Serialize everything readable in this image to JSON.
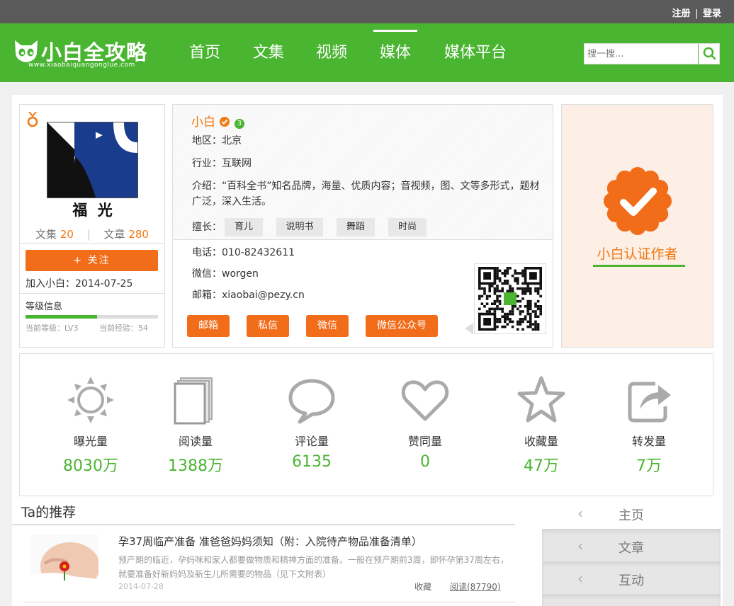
{
  "topbar": {
    "register": "注册",
    "divider": "|",
    "login": "登录"
  },
  "header": {
    "logo_title": "小白全攻略",
    "logo_url": "www.xiaobaiquangonglue.com",
    "nav": [
      "首页",
      "文集",
      "视频",
      "媒体",
      "媒体平台"
    ],
    "nav_active": "媒体",
    "search_placeholder": "搜一搜..."
  },
  "profile": {
    "avatar_text": "福  光",
    "collections_label": "文集",
    "collections": "20",
    "articles_label": "文章",
    "articles": "280",
    "follow": "+ 关注",
    "joined": "加入小白：2014-07-25",
    "level_title": "等级信息",
    "level_progress": 0.54,
    "current_level": "当前等级：LV3",
    "current_exp": "当前经验：54"
  },
  "info": {
    "name": "小白",
    "level_badge": "3",
    "region": "地区：北京",
    "industry": "行业：互联网",
    "intro": "介绍：“百科全书”知名品牌，海量、优质内容；音视频，图、文等多形式，题材广泛，深入生活。",
    "skills_label": "擅长：",
    "tags": [
      "育儿",
      "说明书",
      "舞蹈",
      "时尚"
    ],
    "phone": "电话：010-82432611",
    "wechat": "微信：worgen",
    "email": "邮箱：xiaobai@pezy.cn",
    "buttons": [
      "邮箱",
      "私信",
      "微信",
      "微信公众号"
    ]
  },
  "verify": {
    "title": "小白认证作者"
  },
  "stats": [
    {
      "label": "曝光量",
      "value": "8030万",
      "icon": "sun-icon"
    },
    {
      "label": "阅读量",
      "value": "1388万",
      "icon": "document-stack-icon"
    },
    {
      "label": "评论量",
      "value": "6135",
      "icon": "speech-bubble-icon"
    },
    {
      "label": "赞同量",
      "value": "0",
      "icon": "heart-icon"
    },
    {
      "label": "收藏量",
      "value": "47万",
      "icon": "star-icon"
    },
    {
      "label": "转发量",
      "value": "7万",
      "icon": "share-icon"
    }
  ],
  "recommend": {
    "title": "Ta的推荐",
    "article": {
      "title": "孕37周临产准备 准爸爸妈妈须知（附：入院待产物品准备清单）",
      "desc": "预产期的临近，孕妈咪和家人都要做物质和精神方面的准备。一般在预产期前3周，即怀孕第37周左右，就要准备好新妈妈及新生儿所需要的物品（见下文附表）",
      "date": "2014-07-28",
      "fav": "收藏",
      "read": "阅读(87790)"
    }
  },
  "sidebar": [
    "主页",
    "文章",
    "互动"
  ],
  "colors": {
    "green": "#4ab531",
    "orange": "#f26d1a",
    "topbar": "#5a5a5a"
  }
}
